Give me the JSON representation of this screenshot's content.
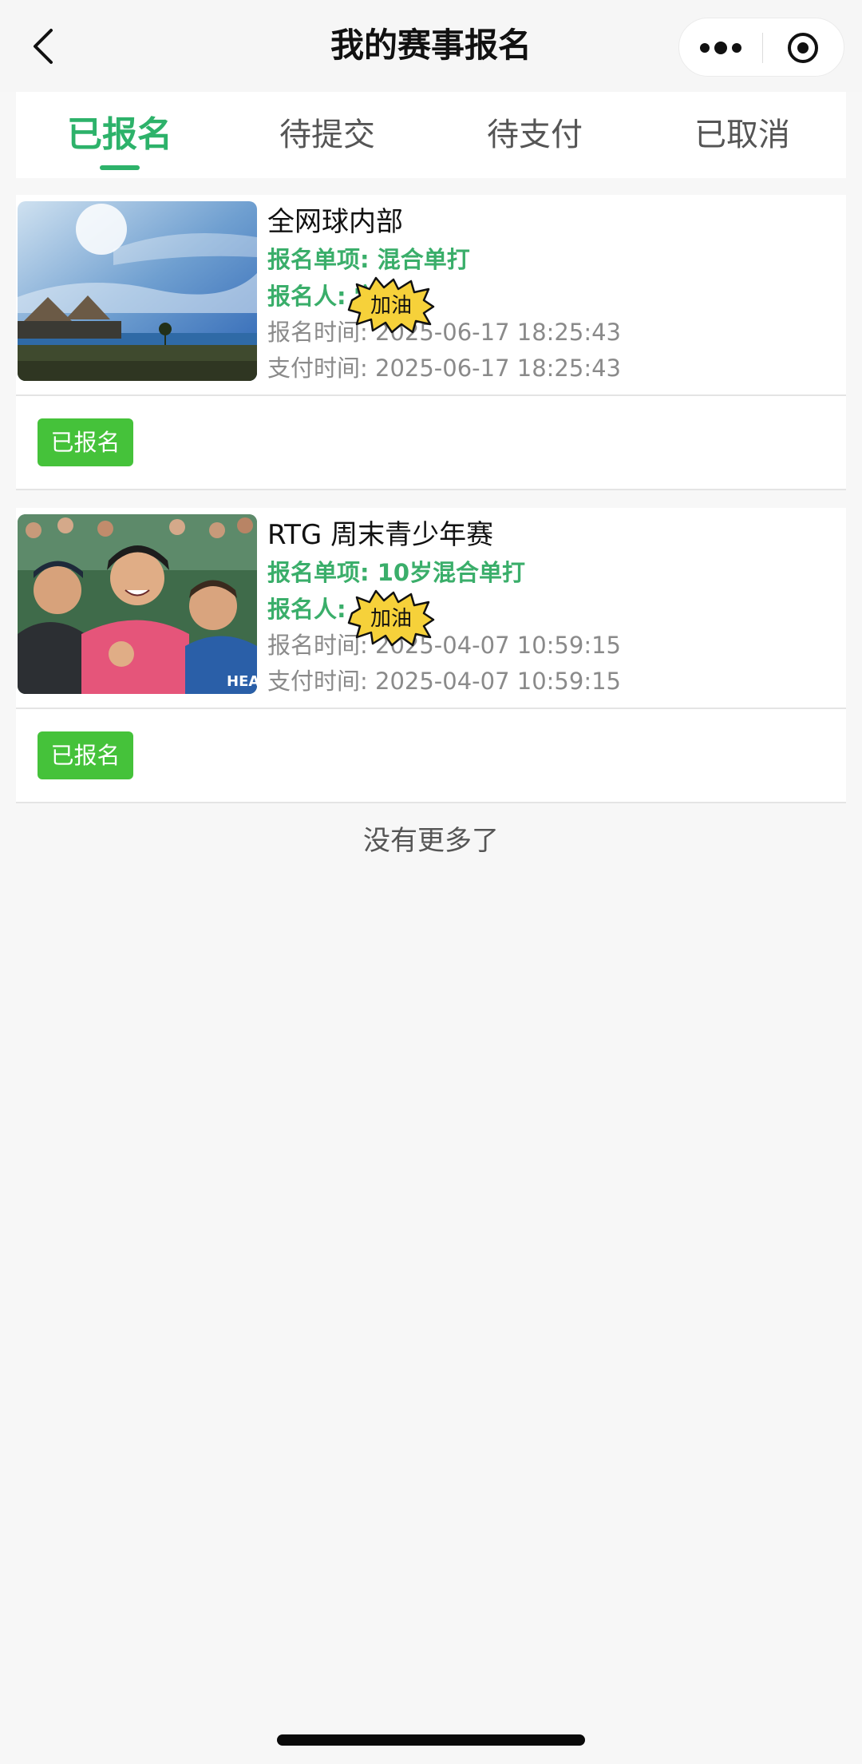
{
  "header": {
    "title": "我的赛事报名"
  },
  "tabs": [
    {
      "label": "已报名",
      "active": true
    },
    {
      "label": "待提交",
      "active": false
    },
    {
      "label": "待支付",
      "active": false
    },
    {
      "label": "已取消",
      "active": false
    }
  ],
  "registrations": [
    {
      "event_name": "全网球内部",
      "event_item": "报名单项: 混合单打",
      "registrant": "报名人: 学",
      "register_time": "报名时间: 2025-06-17 18:25:43",
      "pay_time": "支付时间: 2025-06-17 18:25:43",
      "status": "已报名"
    },
    {
      "event_name": "RTG 周末青少年赛",
      "event_item": "报名单项: 10岁混合单打",
      "registrant": "报名人:",
      "register_time": "报名时间: 2025-04-07 10:59:15",
      "pay_time": "支付时间: 2025-04-07 10:59:15",
      "status": "已报名"
    }
  ],
  "sticker": {
    "text": "加油"
  },
  "footer": {
    "no_more": "没有更多了"
  },
  "colors": {
    "accent": "#2db26a",
    "badge": "#45c23a",
    "detail_green": "#3aae6a",
    "sticker_yellow": "#f6d13a"
  }
}
